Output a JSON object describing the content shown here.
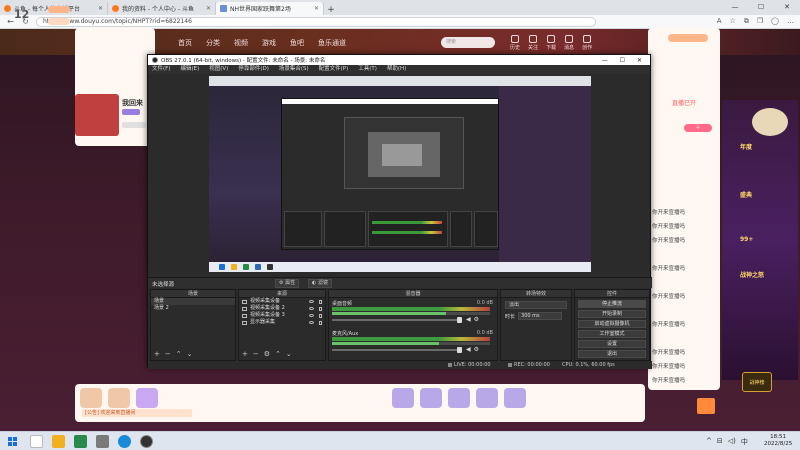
{
  "browser": {
    "tabs": [
      {
        "label": "斗鱼 - 每个人的直播平台",
        "active": false
      },
      {
        "label": "我的资料 - 个人中心 - 斗鱼",
        "active": false
      },
      {
        "label": "NH世界国家跃舞第2场",
        "active": true
      }
    ],
    "url": "https://www.douyu.com/topic/NHPT?rid=6822146"
  },
  "site": {
    "logo": "斗鱼",
    "nav": [
      "首页",
      "分类",
      "视频",
      "游戏",
      "鱼吧",
      "鱼乐通道"
    ],
    "search_placeholder": "搜索",
    "user_icons": [
      "历史",
      "关注",
      "下载",
      "消息",
      "创作"
    ],
    "level_number": "12",
    "anchor_name": "我回来",
    "live_status": "直播已开",
    "chat_lines": [
      "你开来宣播吗",
      "你开来宣播吗",
      "你开来宣播吗",
      "你开来宣播吗",
      "你开来宣播吗",
      "你开来宣播吗",
      "你开来宣播吗",
      "你开来宣播吗",
      "你开来宣播吗"
    ],
    "promo_text": "[公告] 欢迎来到直播间",
    "right_banner_lines": [
      "年度",
      "盛典",
      "99+",
      "战神之怒"
    ],
    "rank_badge": "战神榜"
  },
  "obs": {
    "title": "OBS 27.0.1 (64-bit, windows) - 配置文件: 未命名 - 场景: 未命名",
    "menu": [
      "文件(F)",
      "编辑(E)",
      "视图(V)",
      "停靠部件(D)",
      "场景集合(S)",
      "配置文件(P)",
      "工具(T)",
      "帮助(H)"
    ],
    "no_source": "未选择源",
    "properties_label": "属性",
    "filters_label": "滤镜",
    "docks": {
      "scenes": {
        "header": "场景",
        "items": [
          "场景",
          "场景 2"
        ]
      },
      "sources": {
        "header": "来源",
        "items": [
          "视频采集设备",
          "视频采集设备 2",
          "视频采集设备 3",
          "显示器采集"
        ]
      },
      "mixer": {
        "header": "混音器",
        "channels": [
          {
            "name": "桌面音频",
            "db": "0.0 dB",
            "level": 0.72
          },
          {
            "name": "麦克风/Aux",
            "db": "0.0 dB",
            "level": 0.68
          }
        ]
      },
      "transitions": {
        "header": "转场特效",
        "type": "淡出",
        "duration_label": "时长",
        "duration": "300 ms"
      },
      "controls": {
        "header": "控件",
        "buttons": [
          "停止推流",
          "开始录制",
          "启动虚拟摄像机",
          "工作室模式",
          "设置",
          "退出"
        ]
      }
    },
    "status": {
      "live": "LIVE: 00:00:00",
      "rec": "REC: 00:00:00",
      "cpu": "CPU: 0.1%, 60.00 fps"
    }
  },
  "taskbar": {
    "time": "18:51",
    "date": "2022/8/25",
    "tray": [
      "^",
      "中"
    ]
  }
}
